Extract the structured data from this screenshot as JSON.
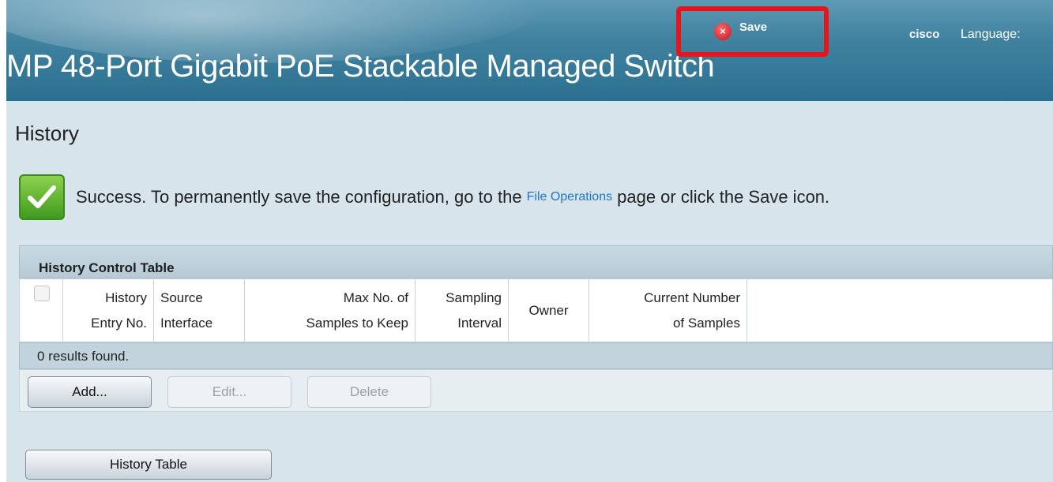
{
  "header": {
    "app_title": "MP 48-Port Gigabit PoE Stackable Managed Switch",
    "save_label": "Save",
    "save_icon_glyph": "×",
    "logo": "cisco",
    "language_label": "Language:"
  },
  "page": {
    "title": "History"
  },
  "notification": {
    "status": "success",
    "text_before": "Success. To permanently save the configuration, go to the",
    "link_text": "File Operations",
    "text_after": "page or click the Save icon."
  },
  "table": {
    "title": "History Control Table",
    "columns": [
      {
        "line1": "History",
        "line2": "Entry No."
      },
      {
        "line1": "Source",
        "line2": "Interface"
      },
      {
        "line1": "Max No. of",
        "line2": "Samples to Keep"
      },
      {
        "line1": "Sampling",
        "line2": "Interval"
      },
      {
        "line1": "Owner",
        "line2": ""
      },
      {
        "line1": "Current Number",
        "line2": "of Samples"
      }
    ],
    "rows": [],
    "results_text": "0 results found."
  },
  "buttons": {
    "add": "Add...",
    "edit": "Edit...",
    "delete": "Delete",
    "history_table": "History Table"
  },
  "colors": {
    "accent_red": "#e8141c",
    "header_blue": "#3f819f",
    "link_blue": "#1f77c4",
    "success_green": "#5bb531"
  }
}
